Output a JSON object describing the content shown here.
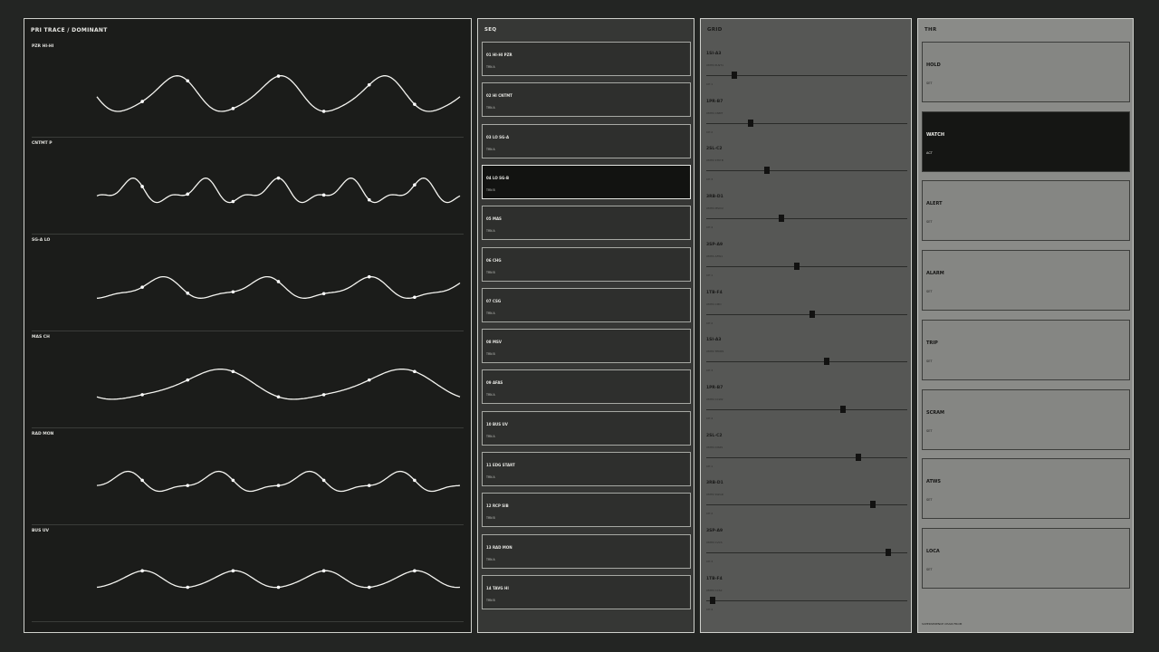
{
  "primary": {
    "title": "PRI TRACE  /  DOMINANT",
    "traces": [
      {
        "label": "PZR HI-HI",
        "amp": 22,
        "cycles": 3.5,
        "phase": 0.0,
        "harm": 0.15
      },
      {
        "label": "CNTMT P",
        "amp": 16,
        "cycles": 5,
        "phase": 0.6,
        "harm": 0.55
      },
      {
        "label": "SG-A LO",
        "amp": 14,
        "cycles": 3.5,
        "phase": 0.3,
        "harm": 0.35
      },
      {
        "label": "MAS CH",
        "amp": 19,
        "cycles": 2,
        "phase": 0.2,
        "harm": 0.2
      },
      {
        "label": "RAD MON",
        "amp": 13,
        "cycles": 4,
        "phase": 0.9,
        "harm": 0.4
      },
      {
        "label": "BUS UV",
        "amp": 10,
        "cycles": 4,
        "phase": 0.5,
        "harm": 0.1
      }
    ]
  },
  "sequence": {
    "title": "SEQ",
    "items": [
      {
        "name": "01 HI-HI PZR",
        "sub": "TRN A",
        "active": false
      },
      {
        "name": "02 HI CNTMT",
        "sub": "TRN A",
        "active": false
      },
      {
        "name": "03 LO SG-A",
        "sub": "TRN A",
        "active": false
      },
      {
        "name": "04 LO SG-B",
        "sub": "TRN B",
        "active": true
      },
      {
        "name": "05 MAS",
        "sub": "TRN A",
        "active": false
      },
      {
        "name": "06 CHG",
        "sub": "TRN B",
        "active": false
      },
      {
        "name": "07 CSG",
        "sub": "TRN A",
        "active": false
      },
      {
        "name": "08 MSV",
        "sub": "TRN B",
        "active": false
      },
      {
        "name": "09 AFAS",
        "sub": "TRN A",
        "active": false
      },
      {
        "name": "10 BUS UV",
        "sub": "TRN A",
        "active": false
      },
      {
        "name": "11 EDG START",
        "sub": "TRN A",
        "active": false
      },
      {
        "name": "12 RCP SIB",
        "sub": "TRN B",
        "active": false
      },
      {
        "name": "13 RAD MON",
        "sub": "TRN A",
        "active": false
      },
      {
        "name": "14 TAVG HI",
        "sub": "TRN B",
        "active": false
      }
    ]
  },
  "grid": {
    "title": "GRID",
    "rows": [
      {
        "code": "1SI-A3",
        "desc": "XMTR PLNT1",
        "sub": "CH 1",
        "value": 0.14
      },
      {
        "code": "1PR-B7",
        "desc": "XMTR CNMT",
        "sub": "CH 2",
        "value": 0.22
      },
      {
        "code": "2SL-C2",
        "desc": "XMTR STM B",
        "sub": "CH 3",
        "value": 0.3
      },
      {
        "code": "3RB-D1",
        "desc": "XMTR MSIV2",
        "sub": "CH 4",
        "value": 0.375
      },
      {
        "code": "3SP-A9",
        "desc": "XMTR AFW1",
        "sub": "CH 1",
        "value": 0.45
      },
      {
        "code": "1TB-F4",
        "desc": "XMTR CMD",
        "sub": "CH 2",
        "value": 0.525
      },
      {
        "code": "1SI-A3",
        "desc": "XMTR TEMP1",
        "sub": "CH 3",
        "value": 0.6
      },
      {
        "code": "1PR-B7",
        "desc": "XMTR CCW2",
        "sub": "CH 4",
        "value": 0.68
      },
      {
        "code": "2SL-C2",
        "desc": "XMTR DISP1",
        "sub": "CH 1",
        "value": 0.755
      },
      {
        "code": "3RB-D1",
        "desc": "XMTR SWGR",
        "sub": "CH 2",
        "value": 0.83
      },
      {
        "code": "3SP-A9",
        "desc": "XMTR CVCS",
        "sub": "CH 3",
        "value": 0.905
      },
      {
        "code": "1TB-F4",
        "desc": "XMTR CCS2",
        "sub": "CH 4",
        "value": 0.03
      }
    ]
  },
  "thresholds": {
    "title": "THR",
    "buttons": [
      {
        "name": "HOLD",
        "state": "SET",
        "active": false
      },
      {
        "name": "WATCH",
        "state": "ACT",
        "active": true
      },
      {
        "name": "ALERT",
        "state": "SET",
        "active": false
      },
      {
        "name": "ALARM",
        "state": "SET",
        "active": false
      },
      {
        "name": "TRIP",
        "state": "SET",
        "active": false
      },
      {
        "name": "SCRAM",
        "state": "SET",
        "active": false
      },
      {
        "name": "ATWS",
        "state": "SET",
        "active": false
      },
      {
        "name": "LOCA",
        "state": "SET",
        "active": false
      }
    ],
    "footnote": "SUPERSEDENCE  CHAIN  FROM"
  },
  "colors": {
    "trace": "#f4f4f0",
    "dot": "#ffffff",
    "panel_dark": "#1b1c1a"
  }
}
